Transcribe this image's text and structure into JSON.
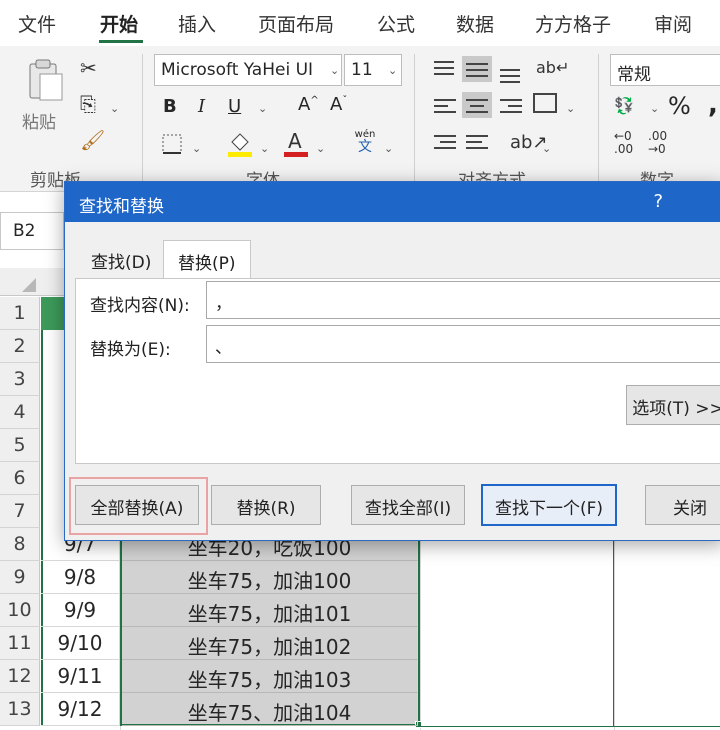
{
  "ribbon_tabs": [
    "文件",
    "开始",
    "插入",
    "页面布局",
    "公式",
    "数据",
    "方方格子",
    "审阅"
  ],
  "active_tab": "开始",
  "ribbon": {
    "paste_label": "粘贴",
    "clipboard_label": "剪贴板",
    "font_name": "Microsoft YaHei UI",
    "font_size": "11",
    "bold": "B",
    "italic": "I",
    "underline": "U",
    "font_group_label": "字体",
    "align_group_label": "对齐方式",
    "number_format": "常规",
    "number_group_label": "数字",
    "percent": "%",
    "wen_label": "wén",
    "wen_char": "文"
  },
  "name_box": "B2",
  "grid": {
    "row_numbers": [
      "1",
      "2",
      "3",
      "4",
      "5",
      "6",
      "7",
      "8",
      "9",
      "10",
      "11",
      "12",
      "13"
    ],
    "rows": [
      {
        "a": "9/7",
        "b": "坐车20，吃饭100"
      },
      {
        "a": "9/8",
        "b": "坐车75，加油100"
      },
      {
        "a": "9/9",
        "b": "坐车75，加油101"
      },
      {
        "a": "9/10",
        "b": "坐车75，加油102"
      },
      {
        "a": "9/11",
        "b": "坐车75，加油103"
      },
      {
        "a": "9/12",
        "b": "坐车75、加油104"
      }
    ]
  },
  "dialog": {
    "title": "查找和替换",
    "help": "?",
    "tab_find": "查找(D)",
    "tab_replace": "替换(P)",
    "find_label": "查找内容(N):",
    "find_value": "，",
    "replace_label": "替换为(E):",
    "replace_value": "、",
    "options_button": "选项(T) >>",
    "replace_all": "全部替换(A)",
    "replace": "替换(R)",
    "find_all": "查找全部(I)",
    "find_next": "查找下一个(F)",
    "close": "关闭"
  },
  "colors": {
    "accent_green": "#217346",
    "dialog_blue": "#1f66c9",
    "highlight_red": "#e9a3a3"
  }
}
